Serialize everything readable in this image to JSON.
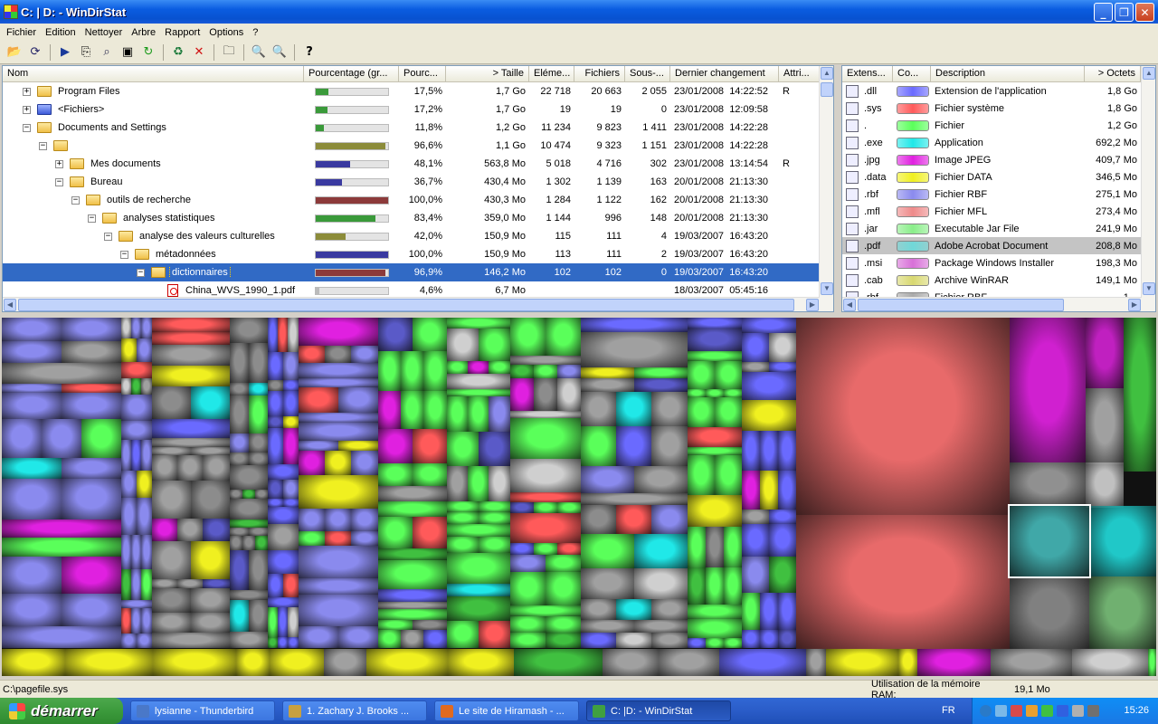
{
  "window": {
    "title": "C: | D: - WinDirStat"
  },
  "menu": [
    "Fichier",
    "Edition",
    "Nettoyer",
    "Arbre",
    "Rapport",
    "Options",
    "?"
  ],
  "toolbar_icons": [
    "open-icon",
    "refresh-icon",
    "play-icon",
    "copy-icon",
    "explore-icon",
    "command-prompt-icon",
    "refresh-selected-icon",
    "recycle-icon",
    "delete-icon",
    "new-folder-icon",
    "zoom-in-icon",
    "zoom-out-icon",
    "help-icon"
  ],
  "tree": {
    "columns": [
      "Nom",
      "Pourcentage (gr...",
      "Pourc...",
      "> Taille",
      "Eléme...",
      "Fichiers",
      "Sous-...",
      "Dernier changement",
      "Attri..."
    ],
    "rows": [
      {
        "indent": 1,
        "exp": "+",
        "icon": "folder",
        "name": "Program Files",
        "bar": 0.175,
        "barcolor": "#3a9a3a",
        "pct": "17,5%",
        "size": "1,7 Go",
        "items": "22 718",
        "files": "20 663",
        "subs": "2 055",
        "date": "23/01/2008",
        "time": "14:22:52",
        "attr": "R"
      },
      {
        "indent": 1,
        "exp": "+",
        "icon": "folder-blue",
        "name": "<Fichiers>",
        "bar": 0.172,
        "barcolor": "#3a9a3a",
        "pct": "17,2%",
        "size": "1,7 Go",
        "items": "19",
        "files": "19",
        "subs": "0",
        "date": "23/01/2008",
        "time": "12:09:58",
        "attr": ""
      },
      {
        "indent": 1,
        "exp": "−",
        "icon": "folder",
        "name": "Documents and Settings",
        "bar": 0.118,
        "barcolor": "#3a9a3a",
        "pct": "11,8%",
        "size": "1,2 Go",
        "items": "11 234",
        "files": "9 823",
        "subs": "1 411",
        "date": "23/01/2008",
        "time": "14:22:28",
        "attr": ""
      },
      {
        "indent": 2,
        "exp": "−",
        "icon": "folder",
        "name": "",
        "bar": 0.966,
        "barcolor": "#8c8c3a",
        "pct": "96,6%",
        "size": "1,1 Go",
        "items": "10 474",
        "files": "9 323",
        "subs": "1 151",
        "date": "23/01/2008",
        "time": "14:22:28",
        "attr": ""
      },
      {
        "indent": 3,
        "exp": "+",
        "icon": "folder",
        "name": "Mes documents",
        "bar": 0.481,
        "barcolor": "#3a3aa0",
        "pct": "48,1%",
        "size": "563,8 Mo",
        "items": "5 018",
        "files": "4 716",
        "subs": "302",
        "date": "23/01/2008",
        "time": "13:14:54",
        "attr": "R"
      },
      {
        "indent": 3,
        "exp": "−",
        "icon": "folder",
        "name": "Bureau",
        "bar": 0.367,
        "barcolor": "#3a3aa0",
        "pct": "36,7%",
        "size": "430,4 Mo",
        "items": "1 302",
        "files": "1 139",
        "subs": "163",
        "date": "20/01/2008",
        "time": "21:13:30",
        "attr": ""
      },
      {
        "indent": 4,
        "exp": "−",
        "icon": "folder",
        "name": "outils de recherche",
        "bar": 1.0,
        "barcolor": "#8c3a3a",
        "pct": "100,0%",
        "size": "430,3 Mo",
        "items": "1 284",
        "files": "1 122",
        "subs": "162",
        "date": "20/01/2008",
        "time": "21:13:30",
        "attr": ""
      },
      {
        "indent": 5,
        "exp": "−",
        "icon": "folder",
        "name": "analyses statistiques",
        "bar": 0.834,
        "barcolor": "#3a9a3a",
        "pct": "83,4%",
        "size": "359,0 Mo",
        "items": "1 144",
        "files": "996",
        "subs": "148",
        "date": "20/01/2008",
        "time": "21:13:30",
        "attr": ""
      },
      {
        "indent": 6,
        "exp": "−",
        "icon": "folder",
        "name": "analyse des valeurs culturelles",
        "bar": 0.42,
        "barcolor": "#8c8c3a",
        "pct": "42,0%",
        "size": "150,9 Mo",
        "items": "115",
        "files": "111",
        "subs": "4",
        "date": "19/03/2007",
        "time": "16:43:20",
        "attr": ""
      },
      {
        "indent": 7,
        "exp": "−",
        "icon": "folder",
        "name": "métadonnées",
        "bar": 1.0,
        "barcolor": "#3a3aa0",
        "pct": "100,0%",
        "size": "150,9 Mo",
        "items": "113",
        "files": "111",
        "subs": "2",
        "date": "19/03/2007",
        "time": "16:43:20",
        "attr": ""
      },
      {
        "indent": 8,
        "exp": "−",
        "icon": "folder",
        "name": "dictionnaires",
        "bar": 0.969,
        "barcolor": "#8c3a3a",
        "pct": "96,9%",
        "size": "146,2 Mo",
        "items": "102",
        "files": "102",
        "subs": "0",
        "date": "19/03/2007",
        "time": "16:43:20",
        "attr": "",
        "selected": true
      },
      {
        "indent": 9,
        "exp": "",
        "icon": "pdf",
        "name": "China_WVS_1990_1.pdf",
        "bar": 0.046,
        "barcolor": "#bbbbbb",
        "pct": "4,6%",
        "size": "6,7 Mo",
        "items": "",
        "files": "",
        "subs": "",
        "date": "18/03/2007",
        "time": "05:45:16",
        "attr": ""
      }
    ]
  },
  "ext": {
    "columns": [
      "Extens...",
      "Co...",
      "Description",
      "> Octets"
    ],
    "rows": [
      {
        "ext": ".dll",
        "color": "#6a6aff",
        "desc": "Extension de l'application",
        "size": "1,8 Go"
      },
      {
        "ext": ".sys",
        "color": "#ff5a5a",
        "desc": "Fichier système",
        "size": "1,8 Go"
      },
      {
        "ext": ".",
        "color": "#5aff5a",
        "desc": "Fichier",
        "size": "1,2 Go"
      },
      {
        "ext": ".exe",
        "color": "#20e8e8",
        "desc": "Application",
        "size": "692,2 Mo"
      },
      {
        "ext": ".jpg",
        "color": "#e020e0",
        "desc": "Image JPEG",
        "size": "409,7 Mo"
      },
      {
        "ext": ".data",
        "color": "#f0f020",
        "desc": "Fichier DATA",
        "size": "346,5 Mo"
      },
      {
        "ext": ".rbf",
        "color": "#8a8aee",
        "desc": "Fichier RBF",
        "size": "275,1 Mo"
      },
      {
        "ext": ".mfl",
        "color": "#ee8a8a",
        "desc": "Fichier MFL",
        "size": "273,4 Mo"
      },
      {
        "ext": ".jar",
        "color": "#8aee8a",
        "desc": "Executable Jar File",
        "size": "241,9 Mo"
      },
      {
        "ext": ".pdf",
        "color": "#70d8d8",
        "desc": "Adobe Acrobat Document",
        "size": "208,8 Mo",
        "selected": true
      },
      {
        "ext": ".msi",
        "color": "#d870d8",
        "desc": "Package Windows Installer",
        "size": "198,3 Mo"
      },
      {
        "ext": ".cab",
        "color": "#d8d870",
        "desc": "Archive WinRAR",
        "size": "149,1 Mo"
      },
      {
        "ext": ".rbf",
        "color": "#aaaaaa",
        "desc": "Fichier RBF",
        "size": "1..."
      }
    ]
  },
  "status": {
    "path": "C:\\pagefile.sys",
    "ram_label": "Utilisation de la mémoire RAM:",
    "ram_value": "19,1 Mo"
  },
  "taskbar": {
    "start": "démarrer",
    "tasks": [
      {
        "label": "lysianne - Thunderbird",
        "color": "#4a78c8"
      },
      {
        "label": "1. Zachary J. Brooks ...",
        "color": "#c8a040"
      },
      {
        "label": "Le site de Hiramash - ...",
        "color": "#e06a20"
      },
      {
        "label": "C: |D: - WinDirStat",
        "color": "#40a040",
        "active": true
      }
    ],
    "lang": "FR",
    "clock": "15:26"
  }
}
